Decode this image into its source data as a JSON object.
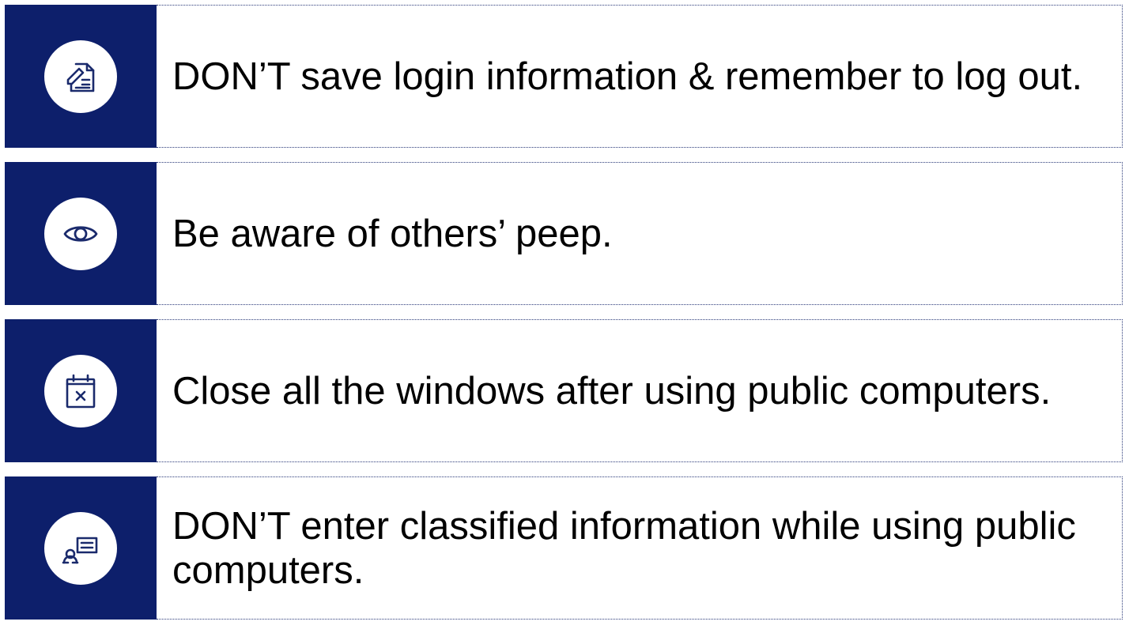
{
  "tips": [
    {
      "icon": "edit-document-icon",
      "text": "DON’T save login information & remember to log out."
    },
    {
      "icon": "eye-icon",
      "text": "Be aware of others’ peep."
    },
    {
      "icon": "calendar-close-icon",
      "text": "Close all the windows after using public computers."
    },
    {
      "icon": "person-message-icon",
      "text": "DON’T enter classified information while using public computers."
    }
  ],
  "colors": {
    "panel": "#0d1f6b",
    "icon_stroke": "#1a2a6c",
    "border": "#2c3b7a"
  }
}
